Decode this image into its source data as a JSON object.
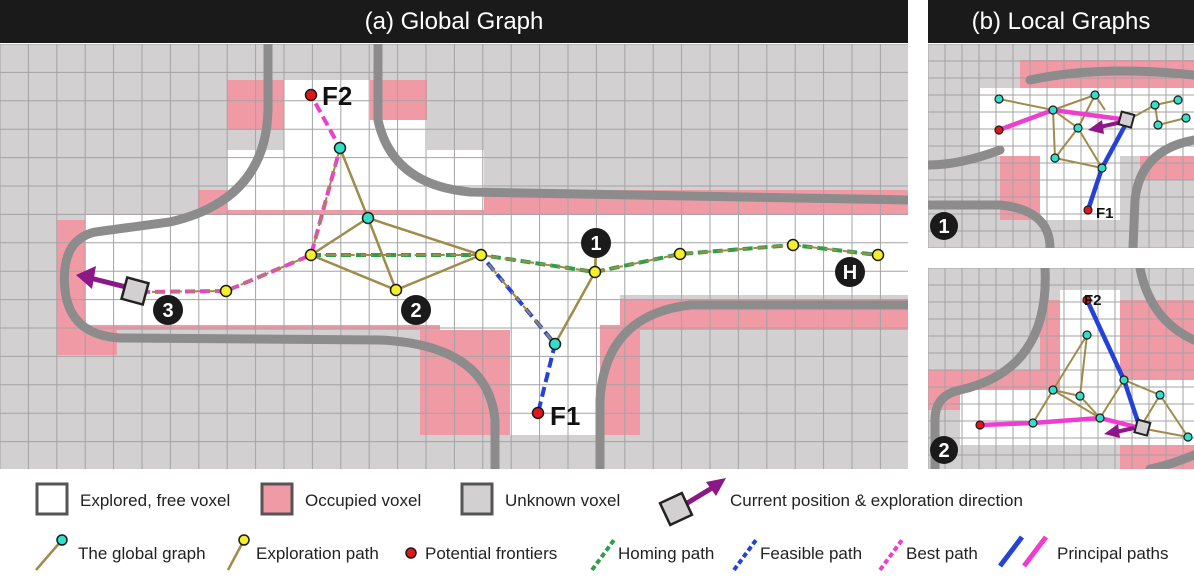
{
  "panels": {
    "global_title": "(a)  Global Graph",
    "local_title": "(b)  Local Graphs"
  },
  "global_labels": {
    "f2": "F2",
    "f1": "F1",
    "home": "H",
    "node1": "1",
    "node2": "2",
    "node3": "3"
  },
  "local_labels": {
    "inset1_f1": "F1",
    "inset1_badge": "1",
    "inset2_f2": "F2",
    "inset2_badge": "2"
  },
  "legend": {
    "explored": "Explored, free voxel",
    "occupied": "Occupied voxel",
    "unknown": "Unknown voxel",
    "current": "Current position & exploration direction",
    "global_graph": "The global graph",
    "exploration_path": "Exploration path",
    "frontiers": "Potential frontiers",
    "homing": "Homing path",
    "feasible": "Feasible path",
    "best": "Best path",
    "principal": "Principal paths"
  },
  "colors": {
    "unknown": "#d3d0d1",
    "occupied": "#f09aa6",
    "free": "#ffffff",
    "grid": "#a3a3a3",
    "wall": "#8c8c8c",
    "graph_edge": "#a08c4a",
    "graph_node": "#33dfc8",
    "path_node": "#f3f02a",
    "frontier": "#e0161b",
    "homing": "#2e9e48",
    "feasible": "#2443d6",
    "best": "#ee3ed0",
    "arrow": "#8c1787",
    "title_bar": "#1a1a1a"
  },
  "icons": {
    "badge": "black-circle-number",
    "current": "square-with-arrow"
  }
}
